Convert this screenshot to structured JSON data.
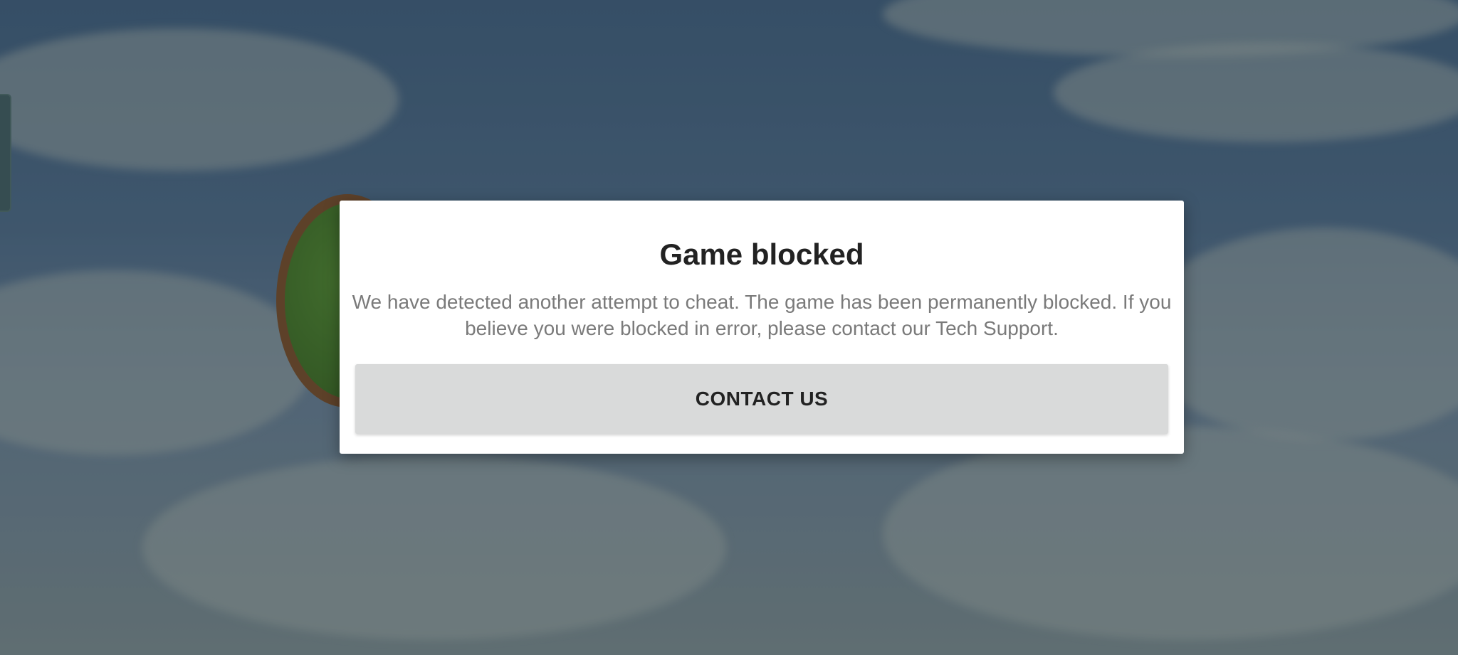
{
  "dialog": {
    "title": "Game blocked",
    "message": "We have detected another attempt to cheat. The game has been permanently blocked. If you believe you were blocked in error, please contact our Tech Support.",
    "button_label": "CONTACT US"
  },
  "colors": {
    "sky": "#3c5a7c",
    "dialog_background": "#ffffff",
    "button_background": "#d9dada",
    "title_text": "#222222",
    "message_text": "#7a7a7a"
  }
}
